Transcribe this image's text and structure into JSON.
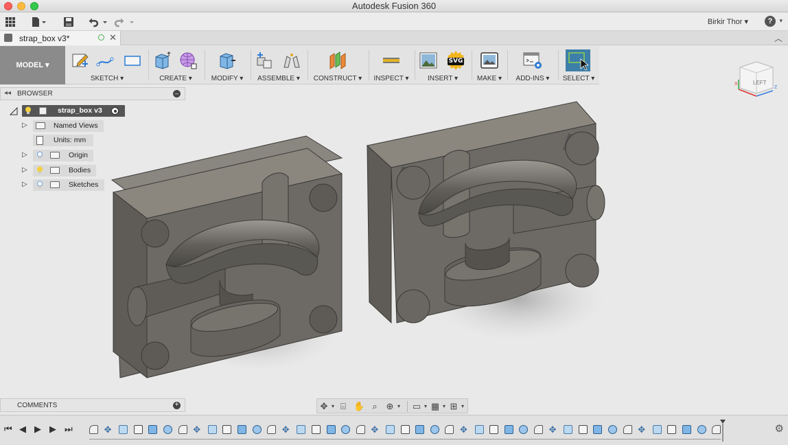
{
  "window": {
    "title": "Autodesk Fusion 360"
  },
  "quick_access": {
    "user": "Birkir Thor ▾",
    "help": "?"
  },
  "document_tab": {
    "name": "strap_box v3*",
    "close": "✕"
  },
  "ribbon": {
    "workspace": "MODEL ▾",
    "groups": [
      {
        "label": "SKETCH ▾"
      },
      {
        "label": "CREATE ▾"
      },
      {
        "label": "MODIFY ▾"
      },
      {
        "label": "ASSEMBLE ▾"
      },
      {
        "label": "CONSTRUCT ▾"
      },
      {
        "label": "INSPECT ▾"
      },
      {
        "label": "INSERT ▾"
      },
      {
        "label": "MAKE ▾"
      },
      {
        "label": "ADD-INS ▾"
      },
      {
        "label": "SELECT ▾"
      }
    ],
    "svg_badge": "SVG"
  },
  "browser": {
    "title": "BROWSER",
    "root": "strap_box v3",
    "items": [
      {
        "label": "Named Views"
      },
      {
        "label": "Units: mm"
      },
      {
        "label": "Origin"
      },
      {
        "label": "Bodies"
      },
      {
        "label": "Sketches"
      }
    ]
  },
  "comments": {
    "title": "COMMENTS"
  },
  "viewcube": {
    "face": "LEFT",
    "axis_x": "X",
    "axis_z": "Z"
  },
  "colors": {
    "part_face": "#6e6b66",
    "part_top": "#8a8680",
    "viewport_bg": "#e9e9e9",
    "select_active": "#3d7fa8",
    "ribbon_bg": "#e3e3e3"
  }
}
